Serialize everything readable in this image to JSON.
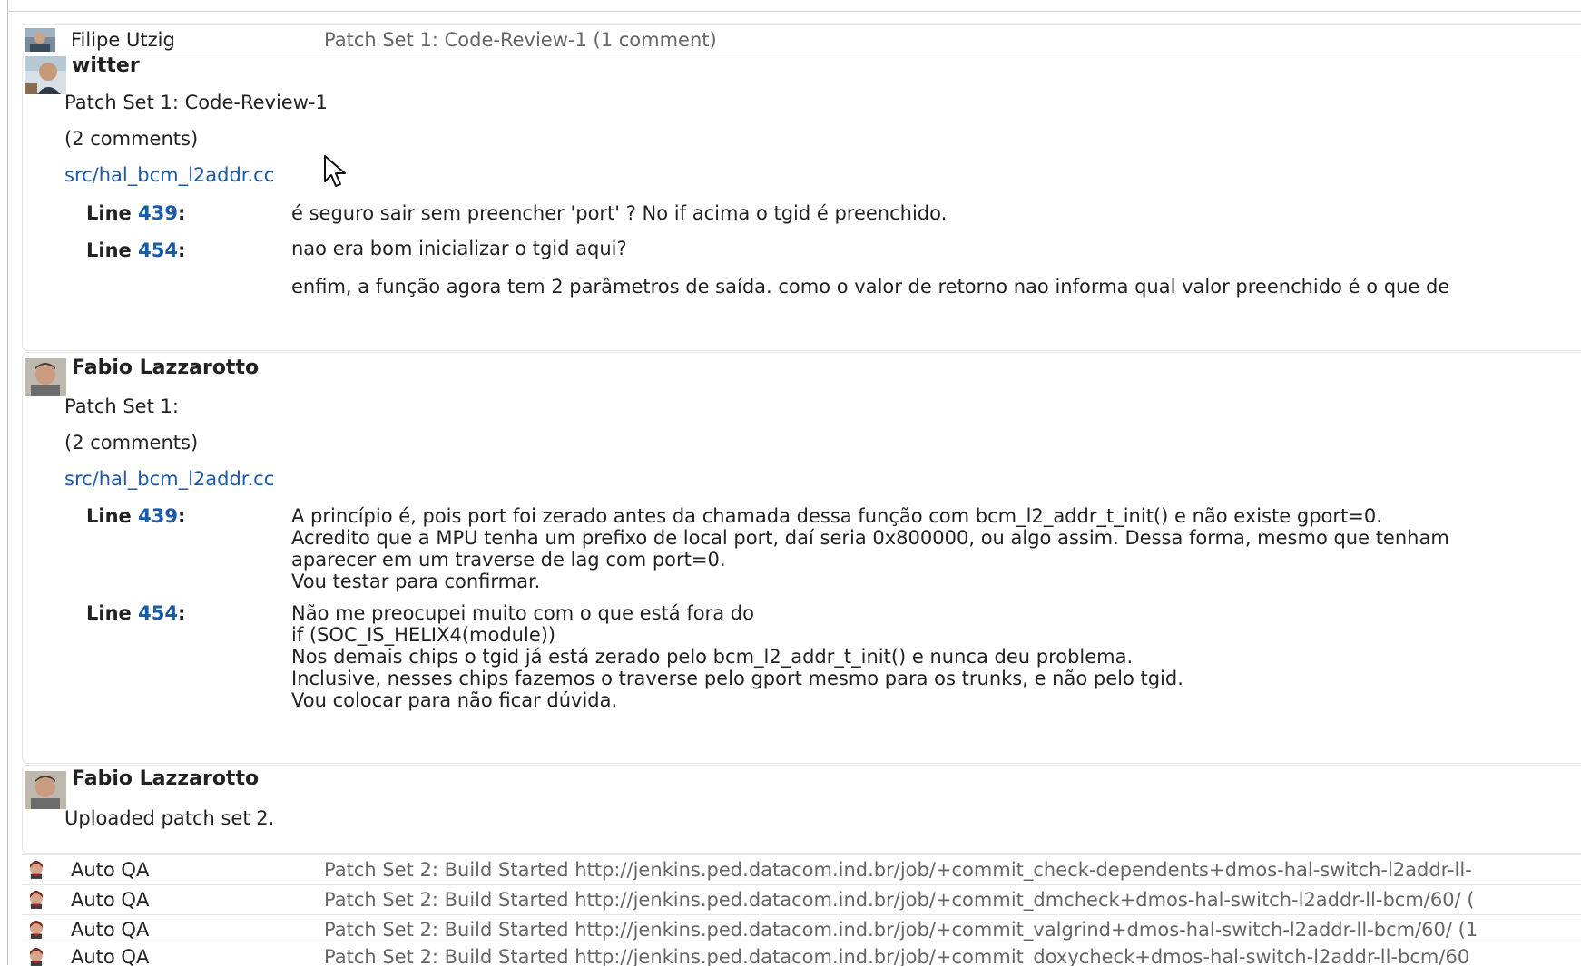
{
  "rows_top": [
    {
      "name": "Filipe Utzig",
      "summary": "Patch Set 1: Code-Review-1 (1 comment)"
    }
  ],
  "messages": [
    {
      "author": "witter",
      "lines": [
        "Patch Set 1: Code-Review-1",
        "(2 comments)"
      ],
      "file": "src/hal_bcm_l2addr.cc",
      "comments": [
        {
          "label": "Line",
          "line": "439",
          "colon": ":",
          "text": "é seguro sair sem preencher 'port' ? No if acima o tgid é preenchido."
        },
        {
          "label": "Line",
          "line": "454",
          "colon": ":",
          "text": "nao era bom inicializar o tgid aqui?\n\nenfim, a função agora tem 2 parâmetros de saída. como o valor de retorno nao informa qual valor preenchido é o que de"
        }
      ]
    },
    {
      "author": "Fabio Lazzarotto",
      "lines": [
        "Patch Set 1:",
        "(2 comments)"
      ],
      "file": "src/hal_bcm_l2addr.cc",
      "comments": [
        {
          "label": "Line",
          "line": "439",
          "colon": ":",
          "text": "A princípio é, pois port foi zerado antes da chamada dessa função com bcm_l2_addr_t_init() e não existe gport=0.\nAcredito que a MPU tenha um prefixo de local port, daí seria 0x800000, ou algo assim. Dessa forma, mesmo que tenham\naparecer em um traverse de lag com port=0.\nVou testar para confirmar."
        },
        {
          "label": "Line",
          "line": "454",
          "colon": ":",
          "text": "Não me preocupei muito com o que está fora do\nif (SOC_IS_HELIX4(module))\nNos demais chips o tgid já está zerado pelo bcm_l2_addr_t_init() e nunca deu problema.\nInclusive, nesses chips fazemos o traverse pelo gport mesmo para os trunks, e não pelo tgid.\nVou colocar para não ficar dúvida."
        }
      ]
    },
    {
      "author": "Fabio Lazzarotto",
      "lines": [
        "Uploaded patch set 2."
      ]
    }
  ],
  "rows_bottom": [
    {
      "name": "Auto QA",
      "summary": "Patch Set 2: Build Started http://jenkins.ped.datacom.ind.br/job/+commit_check-dependents+dmos-hal-switch-l2addr-ll-"
    },
    {
      "name": "Auto QA",
      "summary": "Patch Set 2: Build Started http://jenkins.ped.datacom.ind.br/job/+commit_dmcheck+dmos-hal-switch-l2addr-ll-bcm/60/ ("
    },
    {
      "name": "Auto QA",
      "summary": "Patch Set 2: Build Started http://jenkins.ped.datacom.ind.br/job/+commit_valgrind+dmos-hal-switch-l2addr-ll-bcm/60/ (1"
    },
    {
      "name": "Auto QA",
      "summary": "Patch Set 2: Build Started http://jenkins.ped.datacom.ind.br/job/+commit_doxycheck+dmos-hal-switch-l2addr-ll-bcm/60"
    }
  ],
  "icons": {
    "filipe_avatar": "person-photo-icon",
    "witter_avatar": "person-photo-icon",
    "fabio_avatar": "person-photo-icon",
    "autoqa_avatar": "jenkins-butler-icon",
    "cursor": "mouse-pointer-icon"
  },
  "colors": {
    "link": "#1b5aa8",
    "summary_text": "#666666",
    "border": "#e6e6e6"
  }
}
